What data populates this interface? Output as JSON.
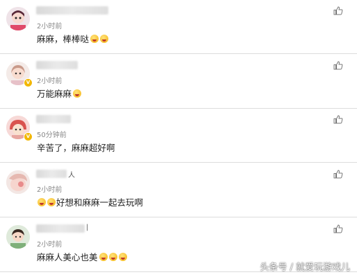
{
  "comments": [
    {
      "time": "2小时前",
      "text": "麻麻，棒棒哒",
      "emoji_after": 2,
      "emoji_before": 0,
      "like": "",
      "name_tail": "",
      "vip": false
    },
    {
      "time": "2小时前",
      "text": "万能麻麻",
      "emoji_after": 1,
      "emoji_before": 0,
      "like": "",
      "name_tail": "",
      "vip": true
    },
    {
      "time": "50分钟前",
      "text": "辛苦了，麻麻超好啊",
      "emoji_after": 0,
      "emoji_before": 0,
      "like": "",
      "name_tail": "",
      "vip": true
    },
    {
      "time": "2小时前",
      "text": "好想和麻麻一起去玩啊",
      "emoji_after": 0,
      "emoji_before": 2,
      "like": "",
      "name_tail": "人",
      "vip": false
    },
    {
      "time": "2小时前",
      "text": "麻麻人美心也美",
      "emoji_after": 3,
      "emoji_before": 0,
      "like": "",
      "name_tail": "|",
      "vip": false
    }
  ],
  "watermark": "头条号 / 就爱玩游戏儿",
  "icons": {
    "like": "thumbs-up-icon",
    "vip": "vip-badge-icon"
  },
  "colors": {
    "text": "#222222",
    "time": "#888888",
    "divider": "#dcdcdc",
    "badge": "#f2b705"
  }
}
